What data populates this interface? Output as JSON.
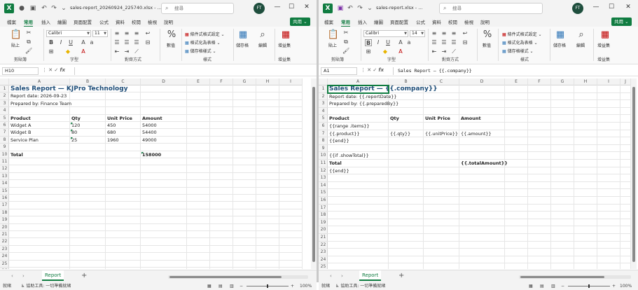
{
  "left_window": {
    "filename": "sales-report_20260924_225740.xlsx - ...",
    "search_placeholder": "搜尋",
    "avatar": "FT",
    "name_box": "H10",
    "formula_value": "",
    "columns": [
      "A",
      "B",
      "C",
      "D",
      "E",
      "F",
      "G",
      "H",
      "I"
    ],
    "rows": [
      "1",
      "2",
      "3",
      "4",
      "5",
      "6",
      "7",
      "8",
      "9",
      "10",
      "11",
      "12",
      "13",
      "14",
      "15",
      "16",
      "17",
      "18",
      "19",
      "20",
      "21",
      "22",
      "23",
      "24",
      "25",
      "26",
      "27",
      "28",
      "29"
    ],
    "cells": {
      "a1": "Sales Report — KJPro Technology",
      "a2": "Report date: 2026-09-23",
      "a3": "Prepared by: Finance Team",
      "a5": "Product",
      "b5": "Qty",
      "c5": "Unit Price",
      "d5": "Amount",
      "a6": "Widget A",
      "b6": "120",
      "c6": "450",
      "d6": "54000",
      "a7": "Widget B",
      "b7": "80",
      "c7": "680",
      "d7": "54400",
      "a8": "Service Plan",
      "b8": "25",
      "c8": "1960",
      "d8": "49000",
      "a10": "Total",
      "d10": "158000"
    }
  },
  "right_window": {
    "filename": "sales-report.xlsx - ...",
    "search_placeholder": "搜尋",
    "avatar": "FT",
    "name_box": "A1",
    "formula_value": "Sales Report — {{.company}}",
    "columns": [
      "A",
      "B",
      "C",
      "D",
      "E",
      "F",
      "G",
      "H",
      "I",
      "J"
    ],
    "rows": [
      "1",
      "2",
      "3",
      "4",
      "5",
      "6",
      "7",
      "8",
      "9",
      "10",
      "11",
      "12",
      "13",
      "14",
      "15",
      "16",
      "17",
      "18",
      "19",
      "20",
      "21",
      "22",
      "23",
      "24",
      "25",
      "26",
      "27",
      "28",
      "29"
    ],
    "cells": {
      "a1": "Sales Report — {{.company}}",
      "a2": "Report date: {{.reportDate}}",
      "a3": "Prepared by: {{.preparedBy}}",
      "a5": "Product",
      "b5": "Qty",
      "c5": "Unit Price",
      "d5": "Amount",
      "a6": "{{range .items}}",
      "a7": "{{.product}}",
      "b7": "{{.qty}}",
      "c7": "{{.unitPrice}}",
      "d7": "{{.amount}}",
      "a8": "{{end}}",
      "a10": "{{if .showTotal}}",
      "a11": "Total",
      "d11": "{{.totalAmount}}",
      "a12": "{{end}}"
    }
  },
  "menu": [
    "檔案",
    "常用",
    "插入",
    "繪圖",
    "頁面配置",
    "公式",
    "資料",
    "校閱",
    "檢視",
    "說明"
  ],
  "share_label": "共用",
  "ribbon": {
    "paste": "貼上",
    "clipboard": "剪貼簿",
    "font_group": "字型",
    "font_name": "Calibri",
    "font_size_left": "11",
    "font_size_right": "14",
    "alignment_group": "對齊方式",
    "number_label": "數值",
    "cond_format": "條件式格式設定",
    "format_table": "格式化為表格",
    "cell_styles": "儲存格樣式",
    "styles_group": "樣式",
    "cells_label": "儲存格",
    "editing_label": "編輯",
    "addins_label": "增益集",
    "addins_group": "增益集"
  },
  "sheet_tab": "Report",
  "status": {
    "ready": "就緒",
    "accessibility": "協助工具: 一切準備就緒",
    "zoom": "100%"
  },
  "colors": {
    "accent": "#107c41",
    "title_blue": "#1f4e79"
  }
}
